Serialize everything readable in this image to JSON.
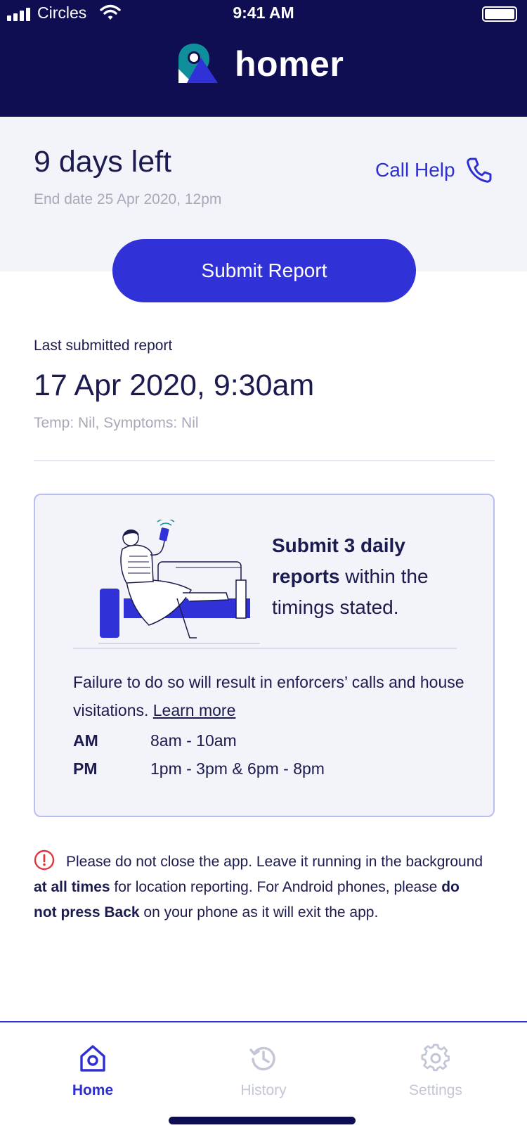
{
  "status_bar": {
    "carrier": "Circles",
    "time": "9:41 AM"
  },
  "header": {
    "app_name": "homer"
  },
  "summary": {
    "days_left": "9 days left",
    "end_date": "End date 25 Apr 2020, 12pm",
    "call_help_label": "Call Help",
    "submit_label": "Submit Report"
  },
  "last_report": {
    "label": "Last submitted report",
    "datetime": "17 Apr 2020, 9:30am",
    "details": "Temp: Nil, Symptoms: Nil"
  },
  "info_card": {
    "headline_bold": "Submit 3 daily reports",
    "headline_rest": "within the timings stated.",
    "body": "Failure to do so will result in enforcers’ calls and house visitations.",
    "learn_more": "Learn more",
    "timings": [
      {
        "label": "AM",
        "value": "8am - 10am"
      },
      {
        "label": "PM",
        "value": "1pm - 3pm & 6pm - 8pm"
      }
    ]
  },
  "warning": {
    "part1": "Please do not close the app. Leave it running in the background",
    "bold1": "at all times",
    "part2": "for location reporting. For Android phones, please",
    "bold2": "do not press Back",
    "part3": "on your phone as it will exit the app."
  },
  "nav": {
    "items": [
      {
        "label": "Home",
        "icon": "home-icon",
        "active": true
      },
      {
        "label": "History",
        "icon": "history-icon",
        "active": false
      },
      {
        "label": "Settings",
        "icon": "gear-icon",
        "active": false
      }
    ]
  },
  "colors": {
    "header_bg": "#0f0e52",
    "accent": "#3131d8",
    "text": "#1b1b50",
    "muted": "#a7a9b8",
    "card_bg": "#f3f4f9",
    "card_border": "#b8bdf3",
    "alert": "#e0363c"
  }
}
